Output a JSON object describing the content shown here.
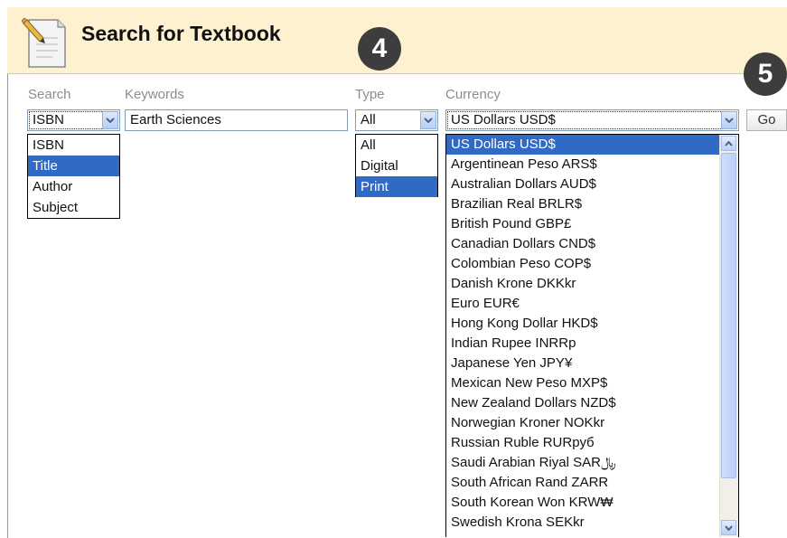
{
  "header": {
    "title": "Search for Textbook",
    "step_badge_4": "4",
    "step_badge_5": "5",
    "colors": {
      "header_bg": "#fdf1cf",
      "selection": "#316ac5",
      "badge": "#3d3d3d"
    }
  },
  "form": {
    "search": {
      "label": "Search",
      "value": "ISBN",
      "options": [
        "ISBN",
        "Title",
        "Author",
        "Subject"
      ],
      "highlighted": "Title"
    },
    "keywords": {
      "label": "Keywords",
      "value": "Earth Sciences"
    },
    "type": {
      "label": "Type",
      "value": "All",
      "options": [
        "All",
        "Digital",
        "Print"
      ],
      "highlighted": "Print"
    },
    "currency": {
      "label": "Currency",
      "value": "US Dollars USD$",
      "options": [
        "US Dollars USD$",
        "Argentinean Peso ARS$",
        "Australian Dollars AUD$",
        "Brazilian Real BRLR$",
        "British Pound GBP£",
        "Canadian Dollars CND$",
        "Colombian Peso COP$",
        "Danish Krone DKKkr",
        "Euro EUR€",
        "Hong Kong Dollar HKD$",
        "Indian Rupee INRRp",
        "Japanese Yen JPY¥",
        "Mexican New Peso MXP$",
        "New Zealand Dollars NZD$",
        "Norwegian Kroner NOKkr",
        "Russian Ruble RURpyб",
        "Saudi Arabian Riyal SAR﷼",
        "South African Rand ZARR",
        "South Korean Won KRW₩",
        "Swedish Krona SEKkr"
      ],
      "highlighted": "US Dollars USD$"
    },
    "go_label": "Go"
  }
}
